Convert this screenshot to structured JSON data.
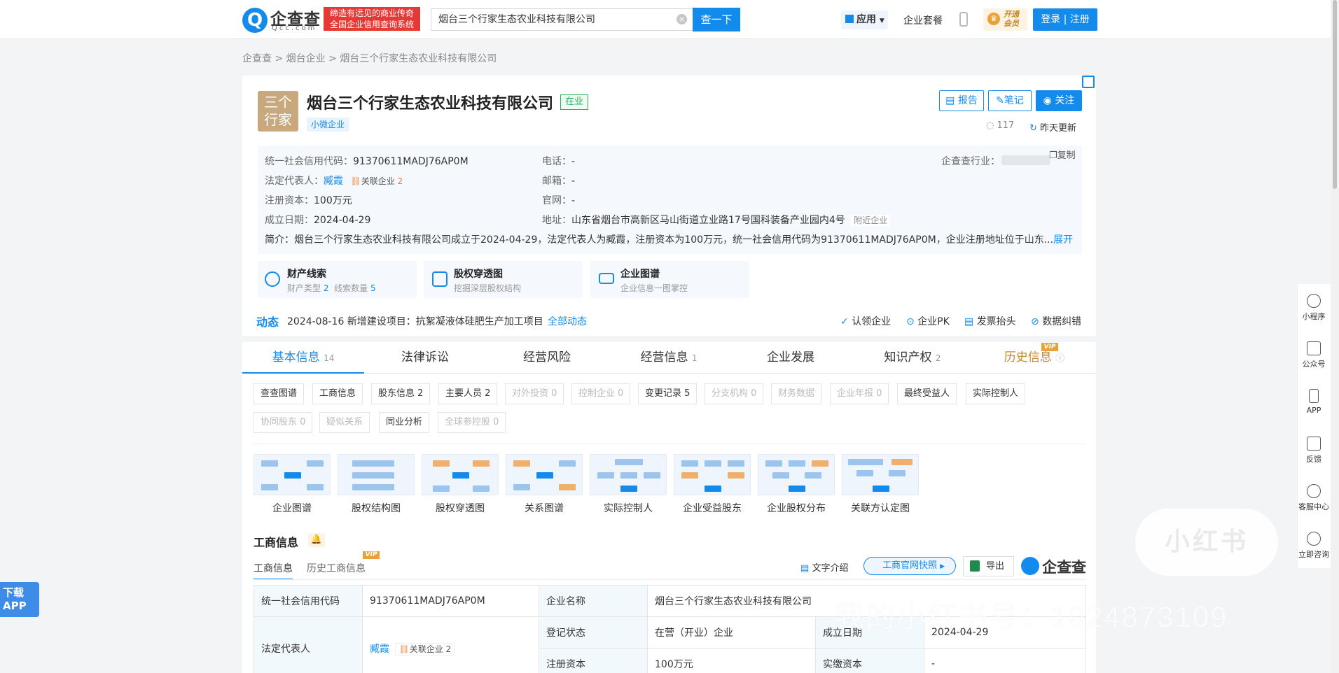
{
  "header": {
    "logo_text": "企查查",
    "logo_sub": "Qcc.com",
    "slogan_line1": "缔造有远见的商业传奇",
    "slogan_line2": "全国企业信用查询系统",
    "search_value": "烟台三个行家生态农业科技有限公司",
    "search_button": "查一下",
    "app_menu": "应用",
    "nav_package": "企业套餐",
    "vip_open": "开通会员",
    "login": "登录 | 注册"
  },
  "breadcrumb": {
    "home": "企查查",
    "sep": ">",
    "region": "烟台企业",
    "current": "烟台三个行家生态农业科技有限公司"
  },
  "company": {
    "logo_line1": "三个",
    "logo_line2": "行家",
    "name": "烟台三个行家生态农业科技有限公司",
    "status": "在业",
    "size_tag": "小微企业",
    "btn_report": "报告",
    "btn_note": "笔记",
    "btn_follow": "关注",
    "views": "117",
    "updated": "昨天更新",
    "copy": "复制"
  },
  "info": {
    "credit_code_label": "统一社会信用代码：",
    "credit_code": "91370611MADJ76AP0M",
    "legal_rep_label": "法定代表人：",
    "legal_rep": "臧霞",
    "related_label": "关联企业",
    "related_count": "2",
    "capital_label": "注册资本：",
    "capital": "100万元",
    "founded_label": "成立日期：",
    "founded": "2024-04-29",
    "phone_label": "电话：",
    "phone": "-",
    "email_label": "邮箱：",
    "email": "-",
    "website_label": "官网：",
    "website": "-",
    "address_label": "地址：",
    "address": "山东省烟台市高新区马山街道立业路17号国科装备产业园内4号",
    "nearby": "附近企业",
    "industry_label": "企查查行业：",
    "intro": "简介：烟台三个行家生态农业科技有限公司成立于2024-04-29，法定代表人为臧霞，注册资本为100万元，统一社会信用代码为91370611MADJ76AP0M，企业注册地址位于山东...",
    "expand": "展开"
  },
  "features": [
    {
      "title": "财产线索",
      "sub_a": "财产类型",
      "sub_a_n": "2",
      "sub_b": "线索数量",
      "sub_b_n": "5"
    },
    {
      "title": "股权穿透图",
      "sub": "挖掘深层股权结构"
    },
    {
      "title": "企业图谱",
      "sub": "企业信息一图掌控"
    }
  ],
  "dynamics": {
    "label": "动态",
    "text": "2024-08-16 新增建设项目：抗絮凝液体硅肥生产加工项目",
    "all": "全部动态",
    "actions": [
      "认领企业",
      "企业PK",
      "发票抬头",
      "数据纠错"
    ]
  },
  "tabs": [
    {
      "label": "基本信息",
      "count": "14"
    },
    {
      "label": "法律诉讼",
      "count": ""
    },
    {
      "label": "经营风险",
      "count": ""
    },
    {
      "label": "经营信息",
      "count": "1"
    },
    {
      "label": "企业发展",
      "count": ""
    },
    {
      "label": "知识产权",
      "count": "2"
    },
    {
      "label": "历史信息",
      "count": ""
    }
  ],
  "vip": "VIP",
  "chips_row1": [
    "查查图谱",
    "工商信息",
    "股东信息 2",
    "主要人员 2",
    "对外投资 0",
    "控制企业 0",
    "变更记录 5",
    "分支机构 0",
    "财务数据",
    "企业年报 0",
    "最终受益人",
    "实际控制人"
  ],
  "chips_row2": [
    "协同股东 0",
    "疑似关系",
    "同业分析",
    "全球参控股 0"
  ],
  "graphs": [
    "企业图谱",
    "股权结构图",
    "股权穿透图",
    "关系图谱",
    "实际控制人",
    "企业受益股东",
    "企业股权分布",
    "关联方认定图"
  ],
  "section": {
    "title": "工商信息",
    "subtab1": "工商信息",
    "subtab2": "历史工商信息",
    "text_intro": "文字介绍",
    "snapshot": "工商官网快照",
    "export": "导出",
    "brand": "企查查"
  },
  "table": {
    "r1c1": "统一社会信用代码",
    "r1c2": "91370611MADJ76AP0M",
    "r1c3": "企业名称",
    "r1c4": "烟台三个行家生态农业科技有限公司",
    "r2c1": "法定代表人",
    "r2c2": "臧霞",
    "r2c2b": "关联企业 2",
    "r2c3": "登记状态",
    "r2c4": "在营（开业）企业",
    "r2c5": "成立日期",
    "r2c6": "2024-04-29",
    "r3c3": "注册资本",
    "r3c4": "100万元",
    "r3c5": "实缴资本",
    "r3c6": "-"
  },
  "sidebar": [
    "小程序",
    "公众号",
    "APP",
    "反馈",
    "客服中心",
    "立即咨询"
  ],
  "download_app": [
    "下载",
    "APP"
  ],
  "watermark": {
    "badge": "小红书",
    "text": "我的小红书号：1024873109"
  }
}
